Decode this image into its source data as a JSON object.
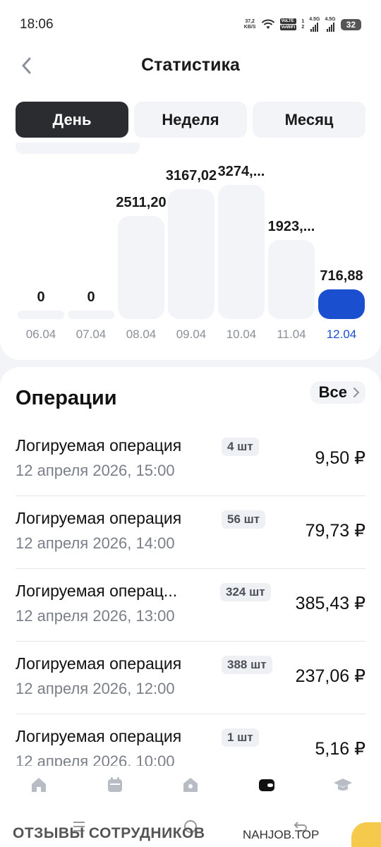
{
  "status_bar": {
    "time": "18:06",
    "net_speed_value": "37,2",
    "net_speed_unit": "KB/S",
    "volte_1": "VoLTE",
    "volte_2": "VoWiFi",
    "sim1_label": "1",
    "sim2_label": "2",
    "signal1_label": "4.5G",
    "signal2_label": "4.5G",
    "battery": "32"
  },
  "header": {
    "title": "Статистика"
  },
  "tabs": [
    {
      "label": "День",
      "active": true
    },
    {
      "label": "Неделя",
      "active": false
    },
    {
      "label": "Месяц",
      "active": false
    }
  ],
  "chart_data": {
    "type": "bar",
    "categories": [
      "06.04",
      "07.04",
      "08.04",
      "09.04",
      "10.04",
      "11.04",
      "12.04"
    ],
    "values": [
      0,
      0,
      2511.2,
      3167.02,
      3274.0,
      1923.0,
      716.88
    ],
    "value_labels": [
      "0",
      "0",
      "2511,20",
      "3167,02",
      "3274,...",
      "1923,...",
      "716,88"
    ],
    "selected_index": 6,
    "selected_color": "#1a4fd0",
    "bar_color": "#f3f4f7"
  },
  "operations": {
    "title": "Операции",
    "all_label": "Все",
    "items": [
      {
        "name": "Логируемая операция",
        "qty": "4 шт",
        "date": "12 апреля 2026, 15:00",
        "amount": "9,50 ₽"
      },
      {
        "name": "Логируемая операция",
        "qty": "56 шт",
        "date": "12 апреля 2026, 14:00",
        "amount": "79,73 ₽"
      },
      {
        "name": "Логируемая операц...",
        "qty": "324 шт",
        "date": "12 апреля 2026, 13:00",
        "amount": "385,43 ₽"
      },
      {
        "name": "Логируемая операция",
        "qty": "388 шт",
        "date": "12 апреля 2026, 12:00",
        "amount": "237,06 ₽"
      },
      {
        "name": "Логируемая операция",
        "qty": "1 шт",
        "date": "12 апреля 2026, 10:00",
        "amount": "5,16 ₽"
      }
    ]
  },
  "bottom_nav": {
    "items": [
      "home-icon",
      "calendar-icon",
      "shop-icon",
      "wallet-icon",
      "graduation-cap-icon"
    ],
    "active_index": 3
  },
  "watermark": {
    "left": "ОТЗЫВЫ СОТРУДНИКОВ",
    "right": "NAHJOB.TOP"
  }
}
